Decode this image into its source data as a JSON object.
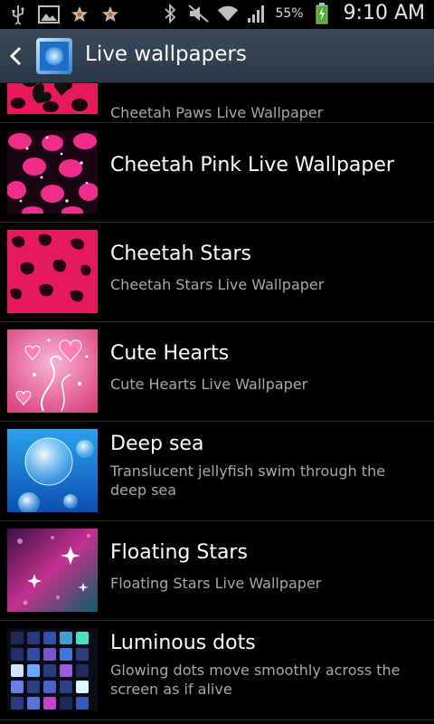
{
  "status_bar": {
    "battery": "55%",
    "time": "9:10 AM",
    "left_icons": [
      "usb-icon",
      "gallery-icon",
      "star-icon",
      "star-icon"
    ],
    "right_icons": [
      "bluetooth-icon",
      "mute-icon",
      "wifi-icon",
      "signal-icon",
      "battery-charging-icon"
    ]
  },
  "action_bar": {
    "title": "Live wallpapers",
    "back_icon": "back-arrow-icon",
    "app_icon": "live-wallpaper-app-icon"
  },
  "items": [
    {
      "title": "",
      "subtitle": "Cheetah Paws Live Wallpaper"
    },
    {
      "title": "Cheetah Pink Live Wallpaper",
      "subtitle": ""
    },
    {
      "title": "Cheetah Stars",
      "subtitle": "Cheetah Stars Live Wallpaper"
    },
    {
      "title": "Cute Hearts",
      "subtitle": "Cute Hearts Live Wallpaper"
    },
    {
      "title": "Deep sea",
      "subtitle": "Translucent jellyfish swim through the deep sea"
    },
    {
      "title": "Floating Stars",
      "subtitle": "Floating Stars Live Wallpaper"
    },
    {
      "title": "Luminous dots",
      "subtitle": "Glowing dots move smoothly across the screen as if alive"
    }
  ]
}
